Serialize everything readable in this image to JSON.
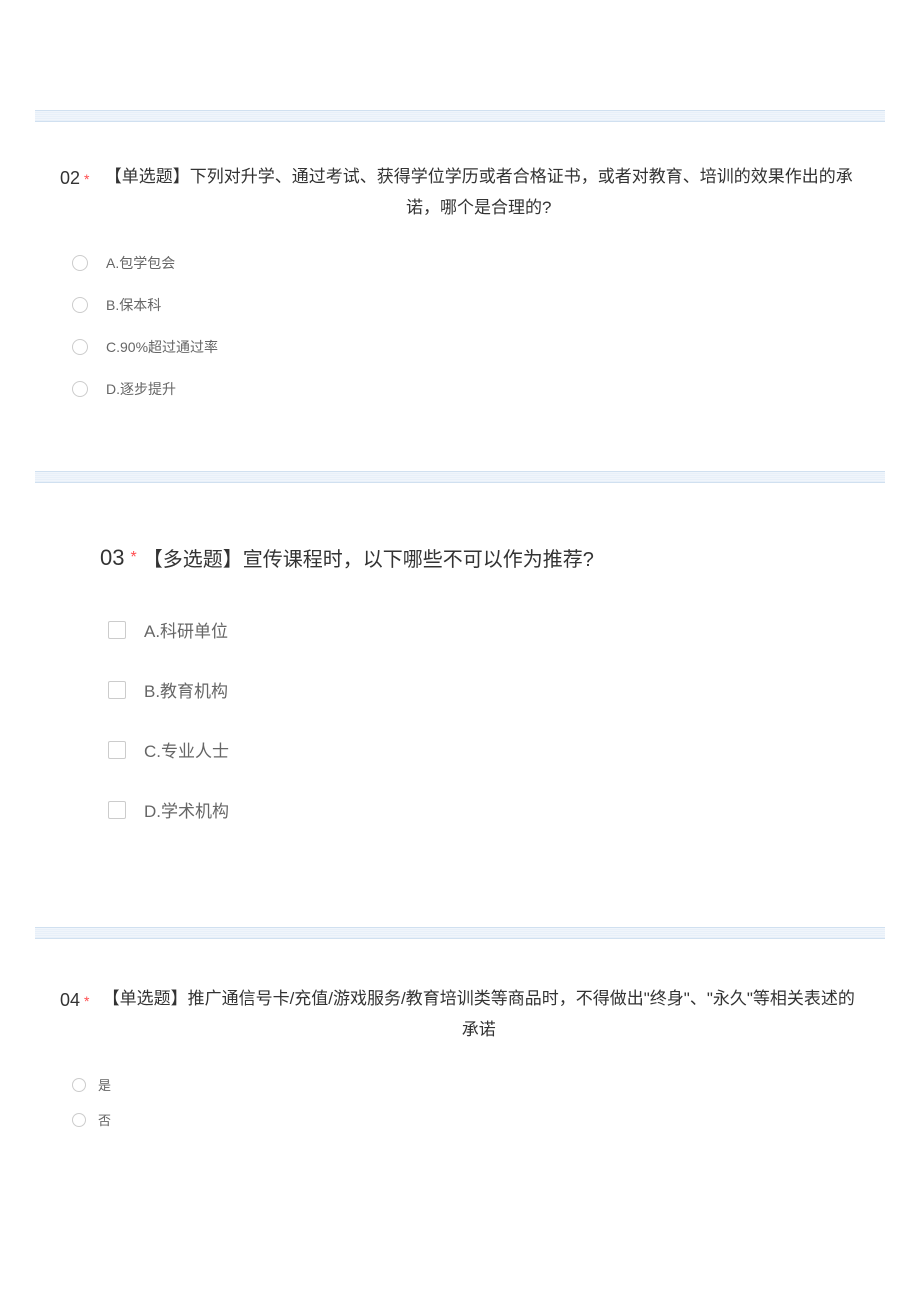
{
  "q2": {
    "number": "02",
    "title": "【单选题】下列对升学、通过考试、获得学位学历或者合格证书，或者对教育、培训的效果作出的承诺，哪个是合理的?",
    "options": [
      "A.包学包会",
      "B.保本科",
      "C.90%超过通过率",
      "D.逐步提升"
    ]
  },
  "q3": {
    "number": "03",
    "title": "【多选题】宣传课程时，以下哪些不可以作为推荐?",
    "options": [
      "A.科研单位",
      "B.教育机构",
      "C.专业人士",
      "D.学术机构"
    ]
  },
  "q4": {
    "number": "04",
    "title": "【单选题】推广通信号卡/充值/游戏服务/教育培训类等商品时，不得做出\"终身\"、\"永久\"等相关表述的承诺",
    "options": [
      "是",
      "否"
    ]
  }
}
